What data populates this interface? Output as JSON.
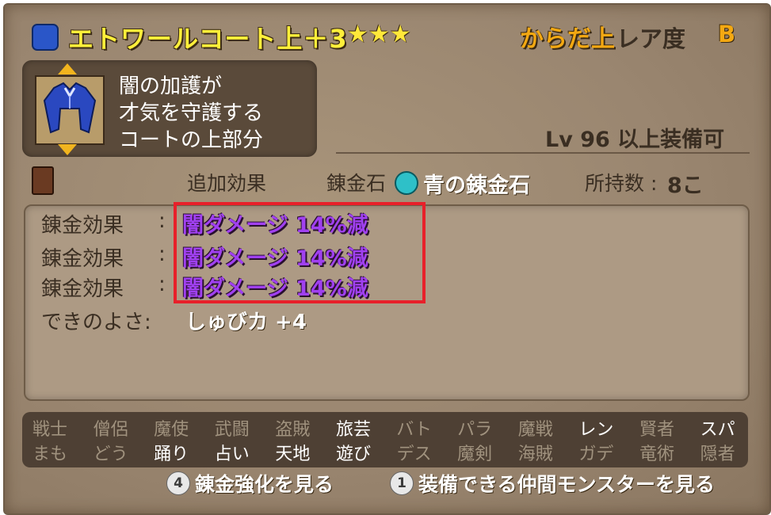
{
  "item": {
    "name": "エトワールコート上＋3",
    "stars": "★★★",
    "slot": "からだ上",
    "rarity_label": "レア度",
    "rarity_value": "B",
    "description": [
      "闇の加護が",
      "才気を守護する",
      "コートの上部分"
    ],
    "requirement": "Lv  96 以上装備可"
  },
  "header": {
    "added_effect_label": "追加効果",
    "alchemy_stone_label": "錬金石",
    "stone_name": "青の錬金石",
    "owned_label": "所持数 :",
    "owned_count": "8こ"
  },
  "effects": [
    {
      "label": "錬金効果",
      "colon": ":",
      "value": "闇ダメージ  14%減"
    },
    {
      "label": "錬金効果",
      "colon": ":",
      "value": "闇ダメージ  14%減"
    },
    {
      "label": "錬金効果",
      "colon": ":",
      "value": "闇ダメージ  14%減"
    }
  ],
  "quality": {
    "label": "できのよさ:",
    "value": "しゅびカ  +4"
  },
  "jobs": [
    {
      "top": "戦士",
      "bottom": "まも",
      "top_on": false,
      "bottom_on": false
    },
    {
      "top": "僧侶",
      "bottom": "どう",
      "top_on": false,
      "bottom_on": false
    },
    {
      "top": "魔使",
      "bottom": "踊り",
      "top_on": false,
      "bottom_on": true
    },
    {
      "top": "武闘",
      "bottom": "占い",
      "top_on": false,
      "bottom_on": true
    },
    {
      "top": "盗賊",
      "bottom": "天地",
      "top_on": false,
      "bottom_on": true
    },
    {
      "top": "旅芸",
      "bottom": "遊び",
      "top_on": true,
      "bottom_on": true
    },
    {
      "top": "バト",
      "bottom": "デス",
      "top_on": false,
      "bottom_on": false
    },
    {
      "top": "パラ",
      "bottom": "魔剣",
      "top_on": false,
      "bottom_on": false
    },
    {
      "top": "魔戦",
      "bottom": "海賊",
      "top_on": false,
      "bottom_on": false
    },
    {
      "top": "レン",
      "bottom": "ガデ",
      "top_on": true,
      "bottom_on": false
    },
    {
      "top": "賢者",
      "bottom": "竜術",
      "top_on": false,
      "bottom_on": false
    },
    {
      "top": "スパ",
      "bottom": "隠者",
      "top_on": true,
      "bottom_on": false
    }
  ],
  "footer": {
    "btn4_key": "4",
    "btn4_label": "錬金強化を見る",
    "btn1_key": "1",
    "btn1_label": "装備できる仲間モンスターを見る"
  },
  "colors": {
    "title": "#ffef3a",
    "slot": "#f3a812",
    "effect": "#a040f0",
    "highlight_border": "#e8202a",
    "job_enabled": "#ffffff",
    "job_disabled": "#a0927e"
  },
  "icons": {
    "item": "armor-body-icon",
    "portrait": "blue-coat-icon",
    "book": "book-icon",
    "stone": "blue-alchemy-stone-icon"
  }
}
